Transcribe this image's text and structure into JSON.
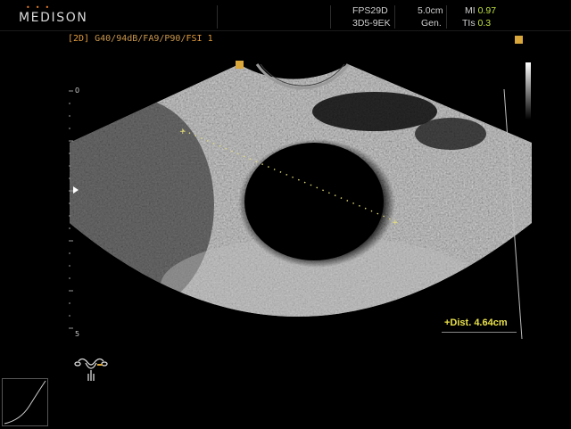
{
  "header": {
    "logo": "MEDISON",
    "logo_dots": "•••",
    "fps": "FPS29D",
    "depth": "5.0cm",
    "probe": "3D5-9EK",
    "mode": "Gen.",
    "mi_label": "MI",
    "mi_value": "0.97",
    "tis_label": "TIs",
    "tis_value": "0.3"
  },
  "preset": {
    "mode": "[2D]",
    "params": "G40/94dB/FA9/P90/",
    "fsi": "FSI 1"
  },
  "depth_scale": {
    "top_label": "0",
    "bottom_label": "5"
  },
  "measurement": {
    "label": "+Dist. 4.64cm",
    "value_cm": 4.64
  },
  "icons": {
    "pictogram": "uterus-ovary-pictogram-icon",
    "position": "probe-orientation-marker-icon",
    "menu": "menu-icon",
    "curve": "gray-map-curve-icon"
  },
  "colors": {
    "accent_orange": "#d9a73a",
    "measure_yellow": "#e8e04a",
    "value_green": "#bfe040"
  }
}
